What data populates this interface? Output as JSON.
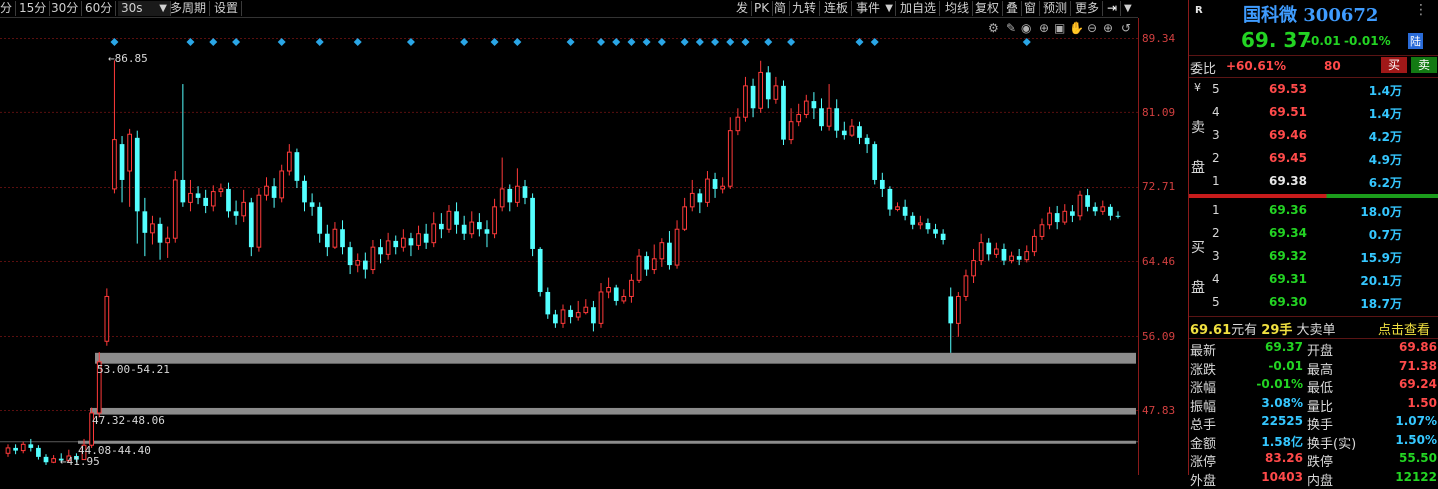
{
  "toolbar": {
    "left_items": [
      "分",
      "15分",
      "30分",
      "60分",
      "30s",
      "多周期",
      "设置"
    ],
    "right_items": [
      "发",
      "PK",
      "简",
      "九转",
      "连板",
      "事件",
      "加自选",
      "均线",
      "复权",
      "叠",
      "窗",
      "预测",
      "更多"
    ]
  },
  "chart": {
    "price_axis": [
      "89.34",
      "81.09",
      "72.71",
      "64.46",
      "56.09",
      "47.83"
    ],
    "annotations": {
      "high": "86.85",
      "low": "41.95",
      "zone1": "53.00-54.21",
      "zone2": "47.32-48.06",
      "zone3": "44.08-44.40"
    },
    "colors": {
      "up": "#ff3a3a",
      "down": "#54ffff",
      "grid": "#5a0f0f",
      "zone": "#8c8c8c",
      "signal": "#2aa6e6"
    }
  },
  "chart_data": {
    "type": "candlestick",
    "ylim": [
      41.0,
      91.0
    ],
    "candles": [
      [
        43.0,
        43.6,
        44.0,
        42.6
      ],
      [
        43.6,
        43.3,
        44.0,
        42.9
      ],
      [
        43.3,
        44.0,
        44.3,
        43.0
      ],
      [
        44.0,
        43.6,
        44.6,
        43.2
      ],
      [
        43.6,
        42.6,
        43.9,
        42.3
      ],
      [
        42.6,
        42.0,
        42.9,
        41.7
      ],
      [
        42.0,
        42.4,
        42.8,
        41.9
      ],
      [
        42.4,
        42.2,
        43.0,
        41.95
      ],
      [
        42.2,
        42.7,
        43.4,
        42.0
      ],
      [
        42.7,
        42.3,
        43.0,
        42.0
      ],
      [
        42.3,
        43.9,
        44.6,
        42.3
      ],
      [
        43.9,
        47.5,
        48.1,
        43.6
      ],
      [
        47.5,
        53.2,
        54.3,
        47.0
      ],
      [
        55.5,
        60.5,
        61.4,
        55.0
      ],
      [
        72.5,
        78.0,
        86.85,
        72.0
      ],
      [
        77.5,
        73.5,
        78.4,
        71.0
      ],
      [
        74.5,
        78.6,
        79.2,
        70.5
      ],
      [
        78.2,
        70.0,
        79.0,
        66.4
      ],
      [
        70.0,
        67.6,
        71.5,
        65.0
      ],
      [
        67.6,
        68.6,
        69.5,
        66.3
      ],
      [
        68.6,
        66.5,
        69.3,
        64.6
      ],
      [
        66.5,
        67.0,
        68.3,
        64.8
      ],
      [
        67.0,
        73.5,
        74.5,
        66.5
      ],
      [
        73.5,
        71.0,
        84.2,
        70.5
      ],
      [
        71.0,
        72.0,
        73.5,
        70.0
      ],
      [
        72.0,
        71.5,
        72.8,
        70.8
      ],
      [
        71.5,
        70.6,
        72.4,
        69.8
      ],
      [
        70.6,
        72.2,
        72.9,
        70.0
      ],
      [
        72.2,
        72.5,
        73.1,
        71.6
      ],
      [
        72.5,
        70.0,
        73.2,
        69.3
      ],
      [
        70.0,
        69.5,
        71.2,
        68.5
      ],
      [
        69.5,
        71.0,
        72.4,
        68.8
      ],
      [
        71.0,
        66.0,
        71.5,
        65.0
      ],
      [
        66.0,
        71.8,
        72.6,
        65.5
      ],
      [
        71.8,
        72.8,
        73.8,
        71.2
      ],
      [
        72.8,
        71.5,
        73.7,
        70.4
      ],
      [
        71.5,
        74.5,
        75.2,
        71.0
      ],
      [
        74.5,
        76.6,
        77.5,
        74.0
      ],
      [
        76.6,
        73.4,
        77.0,
        72.6
      ],
      [
        73.4,
        71.0,
        74.0,
        70.0
      ],
      [
        71.0,
        70.5,
        72.0,
        69.5
      ],
      [
        70.5,
        67.5,
        71.0,
        66.5
      ],
      [
        67.5,
        66.0,
        68.5,
        65.0
      ],
      [
        66.0,
        68.0,
        68.8,
        65.8
      ],
      [
        68.0,
        66.0,
        69.0,
        65.2
      ],
      [
        66.0,
        64.0,
        66.6,
        63.0
      ],
      [
        64.0,
        64.5,
        65.3,
        63.2
      ],
      [
        64.5,
        63.5,
        65.4,
        62.5
      ],
      [
        63.5,
        66.0,
        66.8,
        63.0
      ],
      [
        66.0,
        65.2,
        66.9,
        64.2
      ],
      [
        65.2,
        66.7,
        67.6,
        64.6
      ],
      [
        66.7,
        66.0,
        67.3,
        65.2
      ],
      [
        66.0,
        67.0,
        68.0,
        65.5
      ],
      [
        67.0,
        66.2,
        67.6,
        65.0
      ],
      [
        66.2,
        67.5,
        68.4,
        65.7
      ],
      [
        67.5,
        66.5,
        68.6,
        65.8
      ],
      [
        66.5,
        68.6,
        69.9,
        66.0
      ],
      [
        68.6,
        68.0,
        69.8,
        67.0
      ],
      [
        68.0,
        70.0,
        70.7,
        67.6
      ],
      [
        70.0,
        68.5,
        71.0,
        67.5
      ],
      [
        68.5,
        67.5,
        69.5,
        66.8
      ],
      [
        67.5,
        68.8,
        70.0,
        67.0
      ],
      [
        68.8,
        68.0,
        69.8,
        67.2
      ],
      [
        68.0,
        67.5,
        69.0,
        66.0
      ],
      [
        67.5,
        70.5,
        71.4,
        67.0
      ],
      [
        70.5,
        72.5,
        76.0,
        70.0
      ],
      [
        72.5,
        71.0,
        73.0,
        70.0
      ],
      [
        71.0,
        72.8,
        74.8,
        70.5
      ],
      [
        72.8,
        71.5,
        73.5,
        70.8
      ],
      [
        71.5,
        65.8,
        72.0,
        65.0
      ],
      [
        65.8,
        61.0,
        66.0,
        60.5
      ],
      [
        61.0,
        58.5,
        61.5,
        58.0
      ],
      [
        58.5,
        57.5,
        59.0,
        57.0
      ],
      [
        57.5,
        59.0,
        59.6,
        57.0
      ],
      [
        59.0,
        58.2,
        59.5,
        57.5
      ],
      [
        58.2,
        58.7,
        60.0,
        57.8
      ],
      [
        58.7,
        59.3,
        60.2,
        58.5
      ],
      [
        59.3,
        57.5,
        60.0,
        56.6
      ],
      [
        57.5,
        61.0,
        62.0,
        57.0
      ],
      [
        61.0,
        61.5,
        62.6,
        60.3
      ],
      [
        61.5,
        60.0,
        61.8,
        59.5
      ],
      [
        60.0,
        60.5,
        61.3,
        59.7
      ],
      [
        60.5,
        62.3,
        63.0,
        59.8
      ],
      [
        62.3,
        65.0,
        65.8,
        62.0
      ],
      [
        65.0,
        63.5,
        65.5,
        62.8
      ],
      [
        63.5,
        64.7,
        66.3,
        63.0
      ],
      [
        64.7,
        66.5,
        67.0,
        63.8
      ],
      [
        66.5,
        64.0,
        67.8,
        63.5
      ],
      [
        64.0,
        68.0,
        69.0,
        63.6
      ],
      [
        68.0,
        70.5,
        71.5,
        67.8
      ],
      [
        70.5,
        72.0,
        73.5,
        70.0
      ],
      [
        72.0,
        71.0,
        72.5,
        69.8
      ],
      [
        71.0,
        73.6,
        74.5,
        70.5
      ],
      [
        73.6,
        72.5,
        74.3,
        71.5
      ],
      [
        72.5,
        72.8,
        73.8,
        72.0
      ],
      [
        72.8,
        79.0,
        80.5,
        72.5
      ],
      [
        79.0,
        80.5,
        81.5,
        78.5
      ],
      [
        80.5,
        84.0,
        85.0,
        80.0
      ],
      [
        84.0,
        81.5,
        84.8,
        80.5
      ],
      [
        81.5,
        85.5,
        86.8,
        81.0
      ],
      [
        85.5,
        82.5,
        86.2,
        81.5
      ],
      [
        82.5,
        84.0,
        85.0,
        82.0
      ],
      [
        84.0,
        78.0,
        84.6,
        77.4
      ],
      [
        78.0,
        80.0,
        81.5,
        77.5
      ],
      [
        80.0,
        80.8,
        82.0,
        79.5
      ],
      [
        80.8,
        82.3,
        83.0,
        80.4
      ],
      [
        82.3,
        81.5,
        83.3,
        80.3
      ],
      [
        81.5,
        79.5,
        82.6,
        79.0
      ],
      [
        79.5,
        81.5,
        84.2,
        79.0
      ],
      [
        81.5,
        79.0,
        82.5,
        78.2
      ],
      [
        79.0,
        78.5,
        80.0,
        78.0
      ],
      [
        78.5,
        79.5,
        80.3,
        78.3
      ],
      [
        79.5,
        78.2,
        80.0,
        77.5
      ],
      [
        78.2,
        77.5,
        78.6,
        76.5
      ],
      [
        77.5,
        73.5,
        77.8,
        73.0
      ],
      [
        73.5,
        72.5,
        74.3,
        71.6
      ],
      [
        72.5,
        70.2,
        72.8,
        69.5
      ],
      [
        70.2,
        70.5,
        71.0,
        70.0
      ],
      [
        70.5,
        69.5,
        71.3,
        69.0
      ],
      [
        69.5,
        68.5,
        69.9,
        68.0
      ],
      [
        68.5,
        68.7,
        69.5,
        68.0
      ],
      [
        68.7,
        68.0,
        69.2,
        67.5
      ],
      [
        68.0,
        67.5,
        68.6,
        67.0
      ],
      [
        67.5,
        66.8,
        68.0,
        66.3
      ],
      [
        60.5,
        57.5,
        61.5,
        54.21
      ],
      [
        57.5,
        60.5,
        61.0,
        56.0
      ],
      [
        60.5,
        62.8,
        63.5,
        60.0
      ],
      [
        62.8,
        64.5,
        65.8,
        62.0
      ],
      [
        64.5,
        66.5,
        67.5,
        64.0
      ],
      [
        66.5,
        65.2,
        67.0,
        64.5
      ],
      [
        65.2,
        65.8,
        66.5,
        64.8
      ],
      [
        65.8,
        64.5,
        66.4,
        64.0
      ],
      [
        64.5,
        65.0,
        65.5,
        64.2
      ],
      [
        65.0,
        64.6,
        65.8,
        64.0
      ],
      [
        64.6,
        65.5,
        66.2,
        64.3
      ],
      [
        65.5,
        67.2,
        68.0,
        65.0
      ],
      [
        67.2,
        68.5,
        69.2,
        66.8
      ],
      [
        68.5,
        69.8,
        70.5,
        68.0
      ],
      [
        69.8,
        68.8,
        70.6,
        68.0
      ],
      [
        68.8,
        70.0,
        70.8,
        68.5
      ],
      [
        70.0,
        69.5,
        70.7,
        68.8
      ],
      [
        69.5,
        71.8,
        72.3,
        69.0
      ],
      [
        71.8,
        70.5,
        72.5,
        70.0
      ],
      [
        70.5,
        70.0,
        71.0,
        69.5
      ],
      [
        70.0,
        70.5,
        71.2,
        69.6
      ],
      [
        70.5,
        69.5,
        70.8,
        69.0
      ],
      [
        69.5,
        69.4,
        70.0,
        69.2
      ]
    ],
    "zones": [
      {
        "label": "53.00-54.21",
        "low": 53.0,
        "high": 54.21
      },
      {
        "label": "47.32-48.06",
        "low": 47.32,
        "high": 48.06
      },
      {
        "label": "44.08-44.40",
        "low": 44.08,
        "high": 44.4
      }
    ],
    "signal_indices": [
      14,
      24,
      27,
      30,
      36,
      41,
      46,
      53,
      60,
      64,
      67,
      74,
      78,
      80,
      82,
      84,
      86,
      89,
      91,
      93,
      95,
      97,
      100,
      103,
      112,
      114,
      134
    ]
  },
  "panel": {
    "badge": "R",
    "stock_name": "国科微",
    "stock_code": "300672",
    "last_price": "69. 37",
    "change": "-0.01",
    "change_pct": "-0.01%",
    "board_badge": "陆",
    "weibi_label": "委比",
    "weibi_value": "+60.61%",
    "weicha": "80",
    "buy_btn": "买",
    "sell_btn": "卖",
    "sell_side_label": "卖 盘",
    "buy_side_label": "买 盘",
    "yen": "¥",
    "asks": [
      {
        "level": "5",
        "price": "69.53",
        "vol": "1.4万"
      },
      {
        "level": "4",
        "price": "69.51",
        "vol": "1.4万"
      },
      {
        "level": "3",
        "price": "69.46",
        "vol": "4.2万"
      },
      {
        "level": "2",
        "price": "69.45",
        "vol": "4.9万"
      },
      {
        "level": "1",
        "price": "69.38",
        "vol": "6.2万"
      }
    ],
    "bids": [
      {
        "level": "1",
        "price": "69.36",
        "vol": "18.0万"
      },
      {
        "level": "2",
        "price": "69.34",
        "vol": "0.7万"
      },
      {
        "level": "3",
        "price": "69.32",
        "vol": "15.9万"
      },
      {
        "level": "4",
        "price": "69.31",
        "vol": "20.1万"
      },
      {
        "level": "5",
        "price": "69.30",
        "vol": "18.7万"
      }
    ],
    "big_order": {
      "price": "69.61",
      "yuan_you": "元有",
      "qty": "29手",
      "text": "大卖单",
      "link": "点击查看"
    },
    "stats_left": [
      {
        "label": "最新",
        "value": "69.37"
      },
      {
        "label": "涨跌",
        "value": "-0.01"
      },
      {
        "label": "涨幅",
        "value": "-0.01%"
      },
      {
        "label": "振幅",
        "value": "3.08%"
      },
      {
        "label": "总手",
        "value": "22525"
      },
      {
        "label": "金额",
        "value": "1.58亿"
      },
      {
        "label": "涨停",
        "value": "83.26"
      },
      {
        "label": "外盘",
        "value": "10403"
      }
    ],
    "stats_right": [
      {
        "label": "开盘",
        "value": "69.86"
      },
      {
        "label": "最高",
        "value": "71.38"
      },
      {
        "label": "最低",
        "value": "69.24"
      },
      {
        "label": "量比",
        "value": "1.50"
      },
      {
        "label": "换手",
        "value": "1.07%"
      },
      {
        "label": "换手(实)",
        "value": "1.50%"
      },
      {
        "label": "跌停",
        "value": "55.50"
      },
      {
        "label": "内盘",
        "value": "12122"
      }
    ]
  }
}
